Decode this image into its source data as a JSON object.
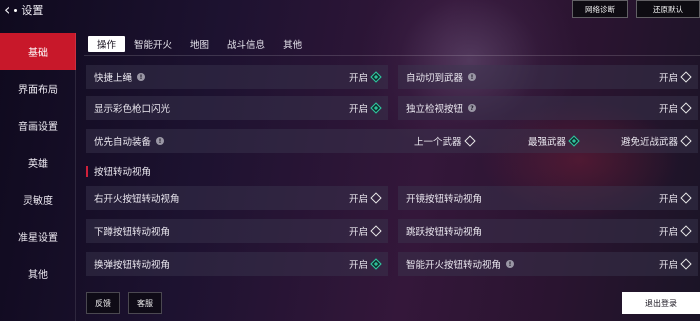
{
  "header": {
    "title": "设置",
    "network_button": "网络诊断",
    "reset_button": "还原默认"
  },
  "sidebar": {
    "items": [
      {
        "label": "基础",
        "active": true
      },
      {
        "label": "界面布局",
        "active": false
      },
      {
        "label": "音画设置",
        "active": false
      },
      {
        "label": "英雄",
        "active": false
      },
      {
        "label": "灵敏度",
        "active": false
      },
      {
        "label": "准星设置",
        "active": false
      },
      {
        "label": "其他",
        "active": false
      }
    ]
  },
  "tabs": [
    {
      "label": "操作",
      "active": true
    },
    {
      "label": "智能开火",
      "active": false
    },
    {
      "label": "地图",
      "active": false
    },
    {
      "label": "战斗信息",
      "active": false
    },
    {
      "label": "其他",
      "active": false
    }
  ],
  "settings": {
    "quick_rope": {
      "label": "快捷上绳",
      "value": "开启",
      "on": true
    },
    "auto_switch_weapon": {
      "label": "自动切到武器",
      "value": "开启",
      "on": false
    },
    "muzzle_flash": {
      "label": "显示彩色枪口闪光",
      "value": "开启",
      "on": true
    },
    "inspect_button": {
      "label": "独立检视按钮",
      "value": "开启",
      "on": false
    },
    "auto_equip": {
      "label": "优先自动装备",
      "options": [
        {
          "label": "上一个武器",
          "on": false
        },
        {
          "label": "最强武器",
          "on": true
        },
        {
          "label": "避免近战武器",
          "on": false
        }
      ]
    }
  },
  "section_title": "按钮转动视角",
  "view_settings": {
    "fire_button": {
      "label": "右开火按钮转动视角",
      "value": "开启",
      "on": false
    },
    "scope_button": {
      "label": "开镜按钮转动视角",
      "value": "开启",
      "on": false
    },
    "crouch_button": {
      "label": "下蹲按钮转动视角",
      "value": "开启",
      "on": false
    },
    "jump_button": {
      "label": "跳跃按钮转动视角",
      "value": "开启",
      "on": false
    },
    "reload_button": {
      "label": "换弹按钮转动视角",
      "value": "开启",
      "on": true
    },
    "smart_fire_button": {
      "label": "智能开火按钮转动视角",
      "value": "开启",
      "on": false
    }
  },
  "footer": {
    "feedback": "反馈",
    "support": "客服",
    "logout": "退出登录"
  },
  "colors": {
    "accent_red": "#c8182a",
    "toggle_on": "#2fbf9a"
  }
}
